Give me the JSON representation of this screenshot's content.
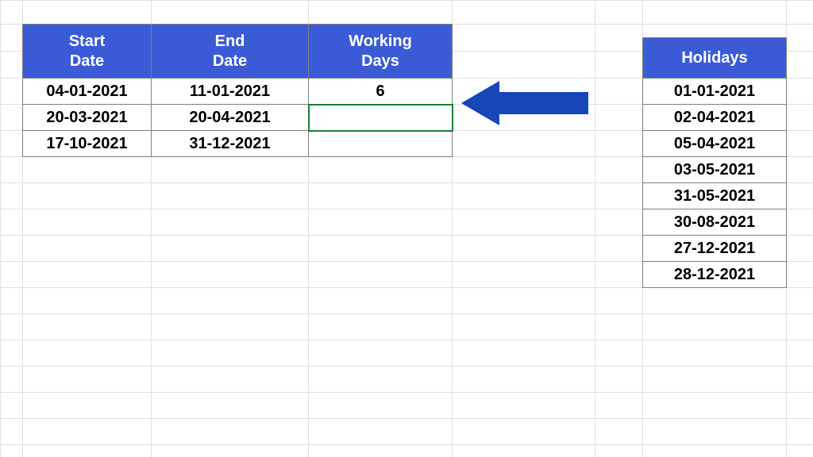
{
  "main_table": {
    "headers": {
      "start": "Start\nDate",
      "end": "End\nDate",
      "working": "Working\nDays"
    },
    "rows": [
      {
        "start": "04-01-2021",
        "end": "11-01-2021",
        "working": "6"
      },
      {
        "start": "20-03-2021",
        "end": "20-04-2021",
        "working": ""
      },
      {
        "start": "17-10-2021",
        "end": "31-12-2021",
        "working": ""
      }
    ]
  },
  "holidays_table": {
    "header": "Holidays",
    "rows": [
      "01-01-2021",
      "02-04-2021",
      "05-04-2021",
      "03-05-2021",
      "31-05-2021",
      "30-08-2021",
      "27-12-2021",
      "28-12-2021"
    ]
  },
  "colors": {
    "header_bg": "#3b5bd6",
    "arrow_fill": "#1646b7"
  }
}
